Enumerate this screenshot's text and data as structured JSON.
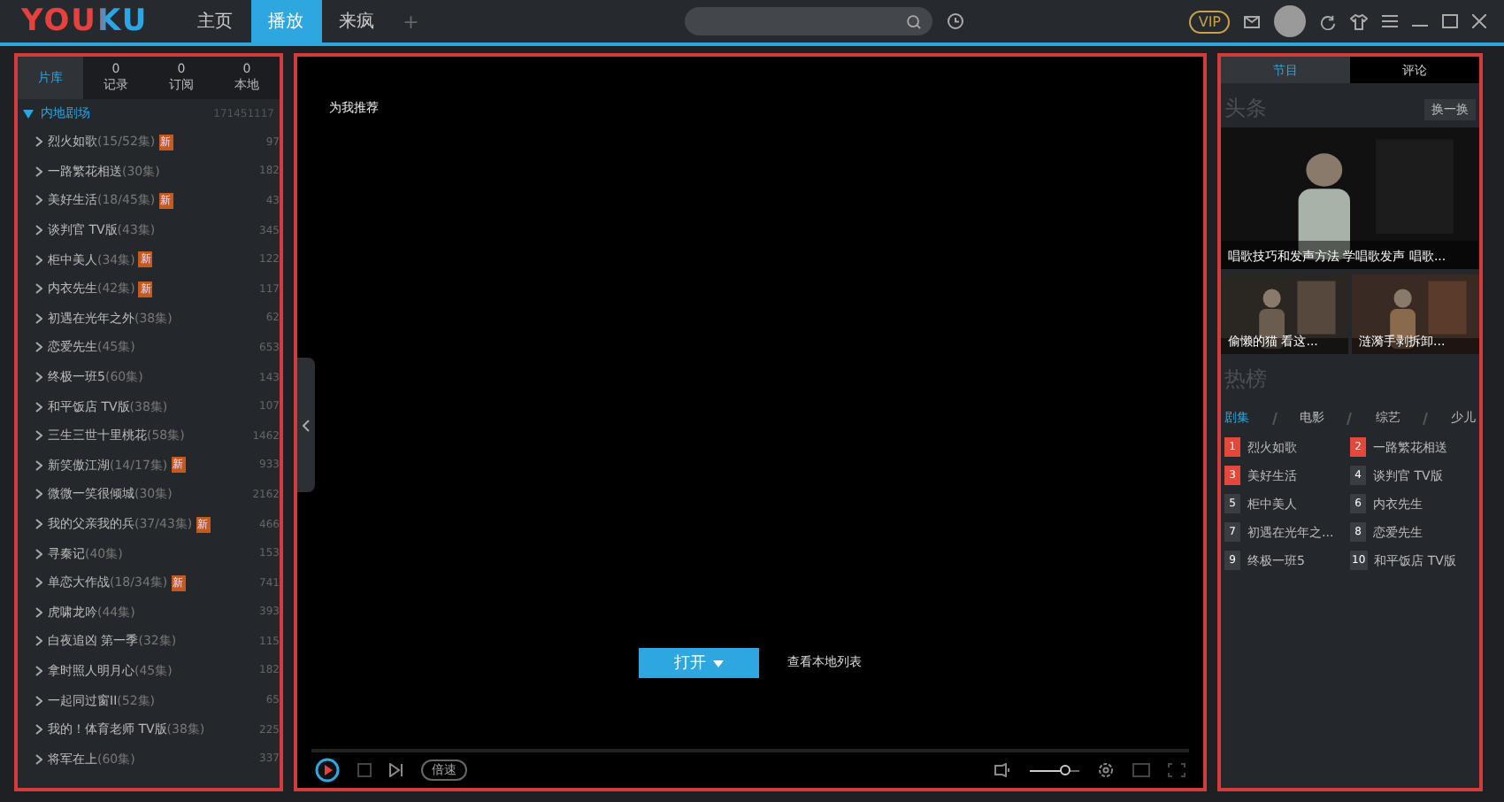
{
  "app": {
    "logo": "YOUKU",
    "nav": [
      {
        "label": "主页",
        "selected": false
      },
      {
        "label": "播放",
        "selected": true
      },
      {
        "label": "来疯",
        "selected": false
      }
    ],
    "add_tab": "+",
    "vip": "VIP"
  },
  "library": {
    "tabs": [
      {
        "label": "片库",
        "selected": true
      },
      {
        "count": "0",
        "label": "记录",
        "selected": false
      },
      {
        "count": "0",
        "label": "订阅",
        "selected": false
      },
      {
        "count": "0",
        "label": "本地",
        "selected": false
      }
    ],
    "group": {
      "title": "内地剧场",
      "count": "171451117",
      "expanded": true
    },
    "items": [
      {
        "title": "烈火如歌",
        "episodes": "(15/52集)",
        "badge": "新",
        "count": "97"
      },
      {
        "title": "一路繁花相送",
        "episodes": "(30集)",
        "count": "182"
      },
      {
        "title": "美好生活",
        "episodes": "(18/45集)",
        "badge": "新",
        "count": "43"
      },
      {
        "title": "谈判官 TV版",
        "episodes": "(43集)",
        "count": "345"
      },
      {
        "title": "柜中美人",
        "episodes": "(34集)",
        "badge": "新",
        "count": "122"
      },
      {
        "title": "内衣先生",
        "episodes": "(42集)",
        "badge": "新",
        "count": "117"
      },
      {
        "title": "初遇在光年之外",
        "episodes": "(38集)",
        "count": "62"
      },
      {
        "title": "恋爱先生",
        "episodes": "(45集)",
        "count": "653"
      },
      {
        "title": "终极一班5",
        "episodes": "(60集)",
        "count": "143"
      },
      {
        "title": "和平饭店 TV版",
        "episodes": "(38集)",
        "count": "107"
      },
      {
        "title": "三生三世十里桃花",
        "episodes": "(58集)",
        "count": "1462"
      },
      {
        "title": "新笑傲江湖",
        "episodes": "(14/17集)",
        "badge": "新",
        "count": "933"
      },
      {
        "title": "微微一笑很倾城",
        "episodes": "(30集)",
        "count": "2162"
      },
      {
        "title": "我的父亲我的兵",
        "episodes": "(37/43集)",
        "badge": "新",
        "count": "466"
      },
      {
        "title": "寻秦记",
        "episodes": "(40集)",
        "count": "153"
      },
      {
        "title": "单恋大作战",
        "episodes": "(18/34集)",
        "badge": "新",
        "count": "741"
      },
      {
        "title": "虎啸龙吟",
        "episodes": "(44集)",
        "count": "393"
      },
      {
        "title": "白夜追凶 第一季",
        "episodes": "(32集)",
        "count": "115"
      },
      {
        "title": "拿时照人明月心",
        "episodes": "(45集)",
        "count": "182"
      },
      {
        "title": "一起同过窗II",
        "episodes": "(52集)",
        "count": "65"
      },
      {
        "title": "我的！体育老师 TV版",
        "episodes": "(38集)",
        "count": "225"
      },
      {
        "title": "将军在上",
        "episodes": "(60集)",
        "count": "337"
      }
    ]
  },
  "player": {
    "recommend": "为我推荐",
    "open_button": "打开",
    "local_list_link": "查看本地列表",
    "speed_button": "倍速",
    "volume": {
      "level": 0.7
    }
  },
  "side": {
    "tabs": [
      {
        "label": "节目",
        "selected": true
      },
      {
        "label": "评论",
        "selected": false
      }
    ],
    "headline_title": "头条",
    "refresh_button": "换一换",
    "headline": {
      "kind": "picture",
      "caption": "唱歌技巧和发声方法 学唱歌发声 唱歌..."
    },
    "thumbs": [
      {
        "kind": "picture",
        "caption": "偷懒的猫 看这..."
      },
      {
        "kind": "picture",
        "caption": "涟漪手剥拆卸..."
      }
    ],
    "hot_title": "热榜",
    "hot_tabs": [
      {
        "label": "剧集",
        "selected": true
      },
      {
        "label": "电影",
        "selected": false
      },
      {
        "label": "综艺",
        "selected": false
      },
      {
        "label": "少儿",
        "selected": false
      }
    ],
    "hot_list": [
      {
        "rank": "1",
        "title": "烈火如歌",
        "color": "#e2493b"
      },
      {
        "rank": "2",
        "title": "一路繁花相送",
        "color": "#e2493b"
      },
      {
        "rank": "3",
        "title": "美好生活",
        "color": "#e2493b"
      },
      {
        "rank": "4",
        "title": "谈判官 TV版",
        "color": "#3a3d42"
      },
      {
        "rank": "5",
        "title": "柜中美人",
        "color": "#3a3d42"
      },
      {
        "rank": "6",
        "title": "内衣先生",
        "color": "#3a3d42"
      },
      {
        "rank": "7",
        "title": "初遇在光年之...",
        "color": "#3a3d42"
      },
      {
        "rank": "8",
        "title": "恋爱先生",
        "color": "#3a3d42"
      },
      {
        "rank": "9",
        "title": "终极一班5",
        "color": "#3a3d42"
      },
      {
        "rank": "10",
        "title": "和平饭店 TV版",
        "color": "#3a3d42"
      }
    ]
  }
}
